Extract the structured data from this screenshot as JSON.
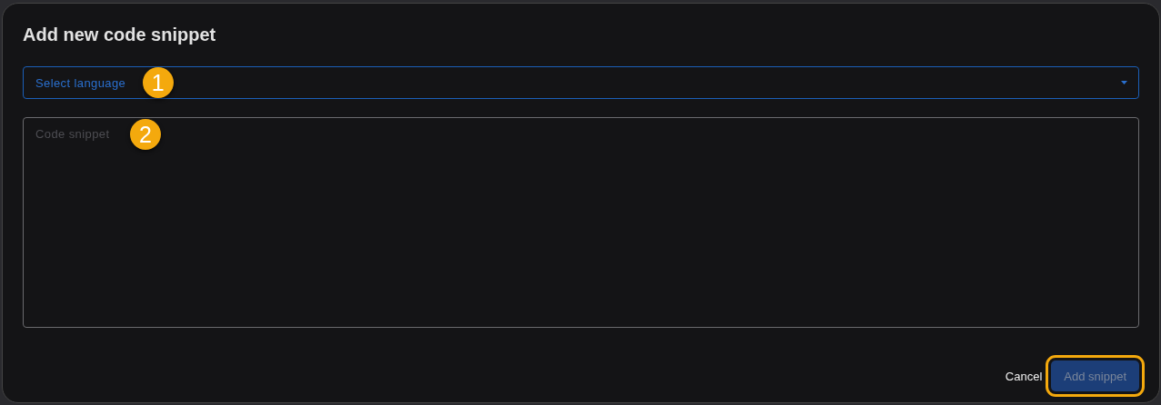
{
  "dialog": {
    "title": "Add new code snippet"
  },
  "language_select": {
    "placeholder": "Select language",
    "focused": true,
    "callout": "1"
  },
  "code_field": {
    "placeholder": "Code snippet",
    "callout": "2"
  },
  "buttons": [
    {
      "label": "Cancel",
      "kind": "text"
    },
    {
      "label": "Add snippet",
      "kind": "primary",
      "disabled": true,
      "highlighted": true
    }
  ]
}
